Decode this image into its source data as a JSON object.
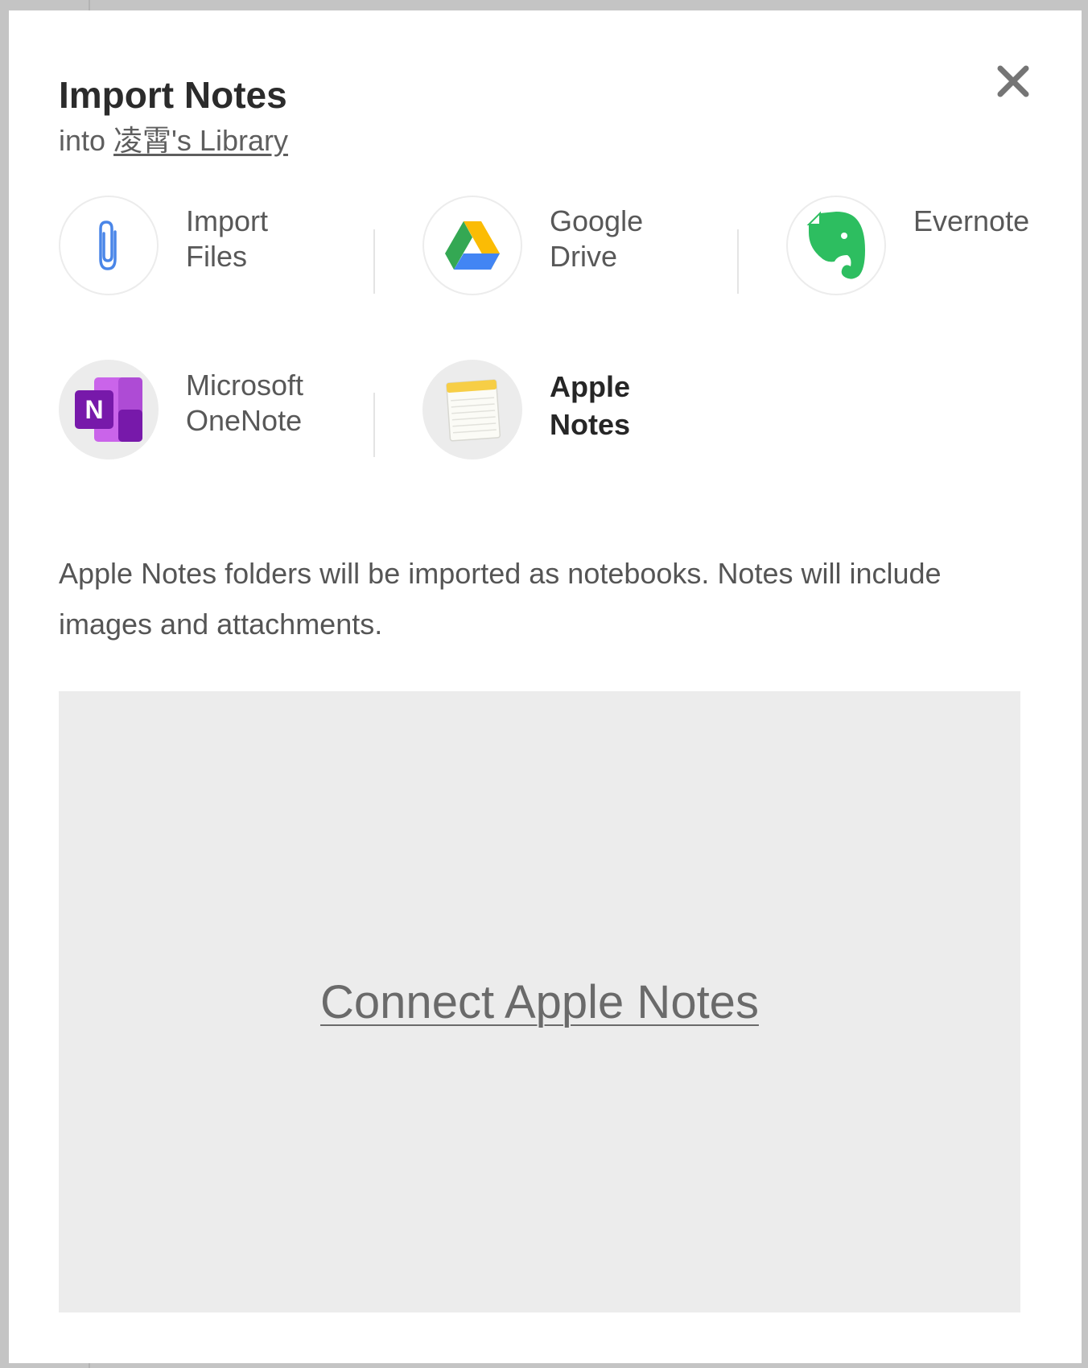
{
  "dialog": {
    "title": "Import Notes",
    "subtitle_prefix": "into ",
    "library_link": "凌霄's Library",
    "close_icon": "close-icon"
  },
  "sources": [
    {
      "line1": "Import",
      "line2": "Files",
      "icon": "paperclip-icon",
      "selected": false
    },
    {
      "line1": "Google",
      "line2": "Drive",
      "icon": "google-drive-icon",
      "selected": false
    },
    {
      "line1": "Evernote",
      "line2": "",
      "icon": "evernote-icon",
      "selected": false
    },
    {
      "line1": "Microsoft",
      "line2": "OneNote",
      "icon": "onenote-icon",
      "selected": false
    },
    {
      "line1": "Apple",
      "line2": "Notes",
      "icon": "apple-notes-icon",
      "selected": true
    }
  ],
  "description": "Apple Notes folders will be imported as notebooks. Notes will include images and attachments.",
  "connect": {
    "label": "Connect Apple Notes"
  },
  "colors": {
    "modal_bg": "#ffffff",
    "backdrop": "#c4c4c4",
    "panel_bg": "#ececec",
    "evernote_green": "#2dbe60",
    "onenote_purple": "#7719aa"
  }
}
